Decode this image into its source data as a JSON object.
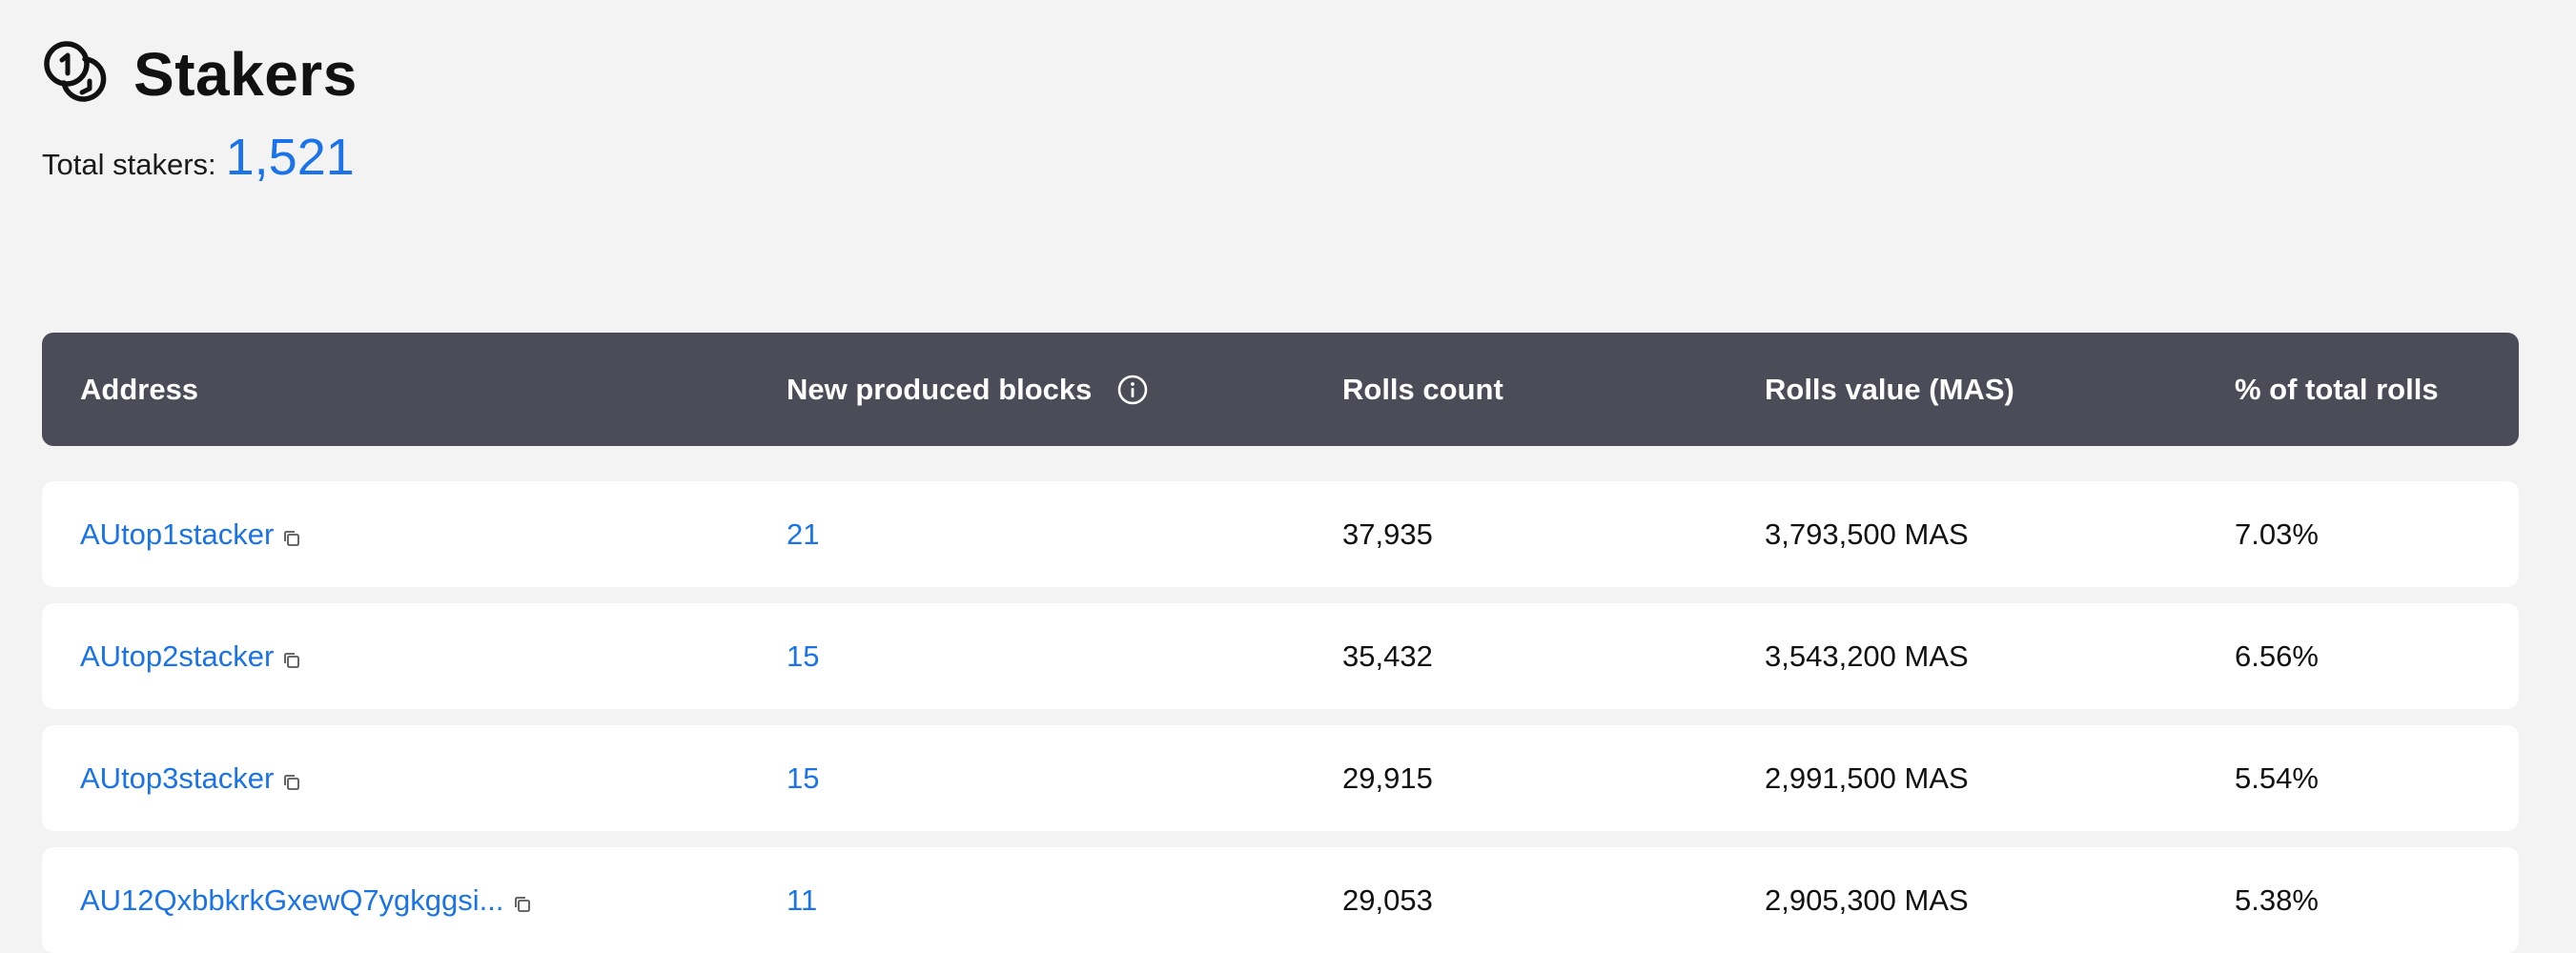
{
  "page": {
    "title": "Stakers",
    "title_icon": "coins-icon",
    "total_label": "Total stakers:",
    "total_value": "1,521"
  },
  "colors": {
    "background": "#f3f3f3",
    "header_background": "#4c4b58",
    "link": "#1a73e8",
    "row_background": "#ffffff"
  },
  "table": {
    "headers": {
      "address": "Address",
      "blocks": "New produced blocks",
      "blocks_icon": "info-icon",
      "rolls": "Rolls count",
      "value": "Rolls value (MAS)",
      "pct": "% of total rolls"
    },
    "rows": [
      {
        "address": "AUtop1stacker",
        "blocks": "21",
        "rolls": "37,935",
        "value": "3,793,500 MAS",
        "pct": "7.03%"
      },
      {
        "address": "AUtop2stacker",
        "blocks": "15",
        "rolls": "35,432",
        "value": "3,543,200 MAS",
        "pct": "6.56%"
      },
      {
        "address": "AUtop3stacker",
        "blocks": "15",
        "rolls": "29,915",
        "value": "2,991,500 MAS",
        "pct": "5.54%"
      },
      {
        "address": "AU12QxbbkrkGxewQ7ygkggsi...",
        "blocks": "11",
        "rolls": "29,053",
        "value": "2,905,300 MAS",
        "pct": "5.38%"
      }
    ]
  }
}
